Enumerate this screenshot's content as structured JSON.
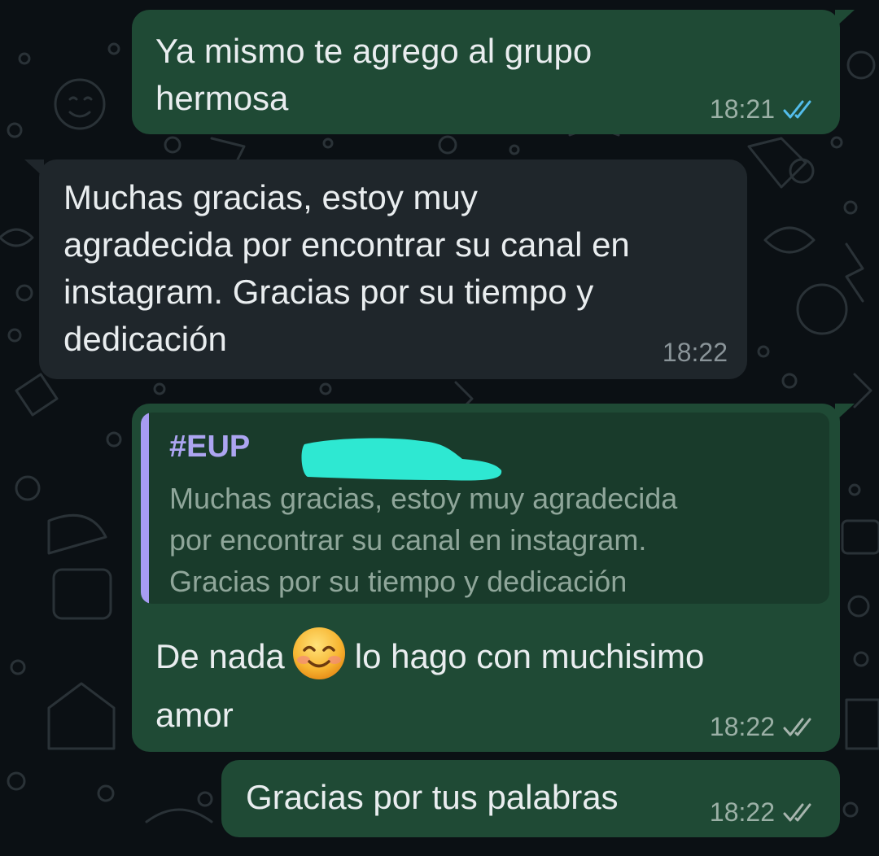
{
  "colors": {
    "outgoing_bubble": "#1f4a35",
    "incoming_bubble": "#1f262b",
    "quote_accent": "#a79cf3",
    "read_ticks": "#53bdeb",
    "delivered_ticks": "#a7b5ae",
    "redaction": "#2ee8d2"
  },
  "messages": [
    {
      "direction": "outgoing",
      "text": "Ya mismo te agrego al grupo\nhermosa",
      "time": "18:21",
      "status": "read",
      "status_icon": "double-check-icon"
    },
    {
      "direction": "incoming",
      "text": "Muchas gracias, estoy muy\nagradecida por encontrar su canal en\ninstagram. Gracias por su tiempo y\ndedicación",
      "time": "18:22"
    },
    {
      "direction": "outgoing",
      "quote": {
        "author": "#EUP",
        "author_redacted": true,
        "text": "Muchas gracias, estoy muy agradecida\npor encontrar su canal en instagram.\nGracias por su tiempo y dedicación"
      },
      "text_before_emoji": "De nada",
      "emoji": "smiling-face-icon",
      "text_after_emoji": "lo hago con muchisimo\namor",
      "time": "18:22",
      "status": "delivered",
      "status_icon": "double-check-icon"
    },
    {
      "direction": "outgoing",
      "text": "Gracias por tus palabras",
      "time": "18:22",
      "status": "delivered",
      "status_icon": "double-check-icon"
    }
  ]
}
